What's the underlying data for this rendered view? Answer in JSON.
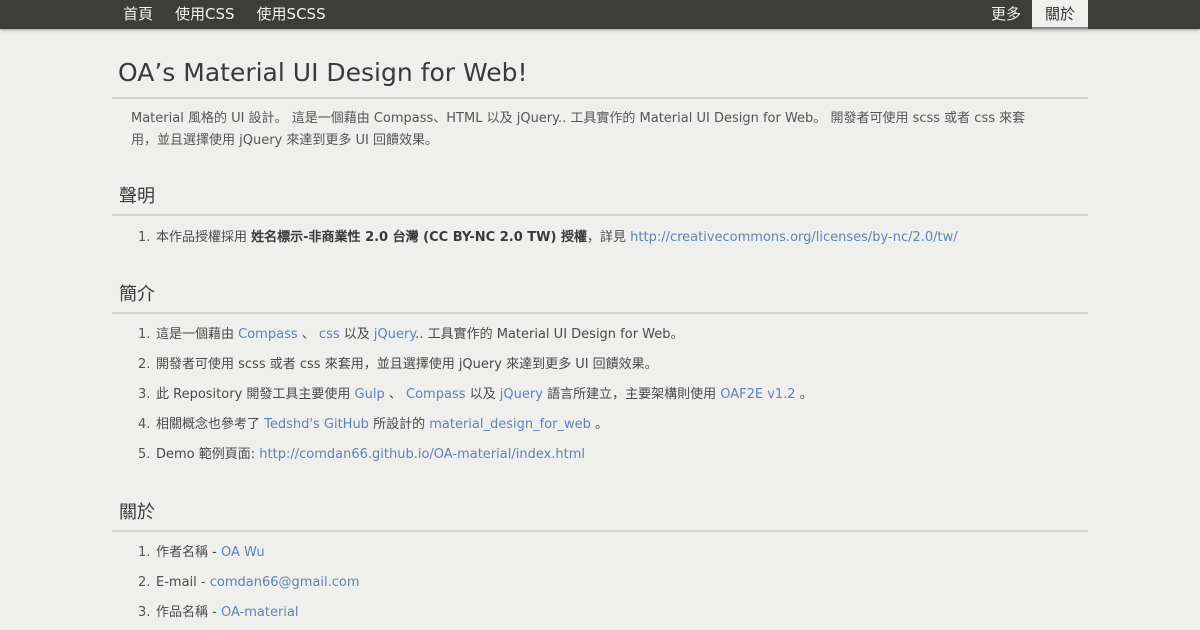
{
  "nav": {
    "left": [
      "首頁",
      "使用CSS",
      "使用SCSS"
    ],
    "right": [
      "更多",
      "關於"
    ]
  },
  "page": {
    "title": "OA’s Material UI Design for Web!",
    "intro": "Material 風格的 UI 設計。 這是一個藉由 Compass、HTML 以及 jQuery.. 工具實作的 Material UI Design for Web。 開發者可使用 scss 或者 css 來套用，並且選擇使用 jQuery 來達到更多 UI 回饋效果。"
  },
  "sections": {
    "statement": {
      "heading": "聲明",
      "item1": {
        "num": "1.",
        "prefix": "本作品授權採用",
        "bold": "姓名標示-非商業性 2.0 台灣 (CC BY-NC 2.0 TW) 授權",
        "mid": "，詳見",
        "link": "http://creativecommons.org/licenses/by-nc/2.0/tw/"
      }
    },
    "intro": {
      "heading": "簡介",
      "item1": {
        "num": "1.",
        "t1": "這是一個藉由",
        "l1": "Compass",
        "t2": "、",
        "l2": "css",
        "t3": "以及",
        "l3": "jQuery",
        "t4": ".. 工具實作的 Material UI Design for Web。"
      },
      "item2": {
        "num": "2.",
        "text": "開發者可使用 scss 或者 css 來套用，並且選擇使用 jQuery 來達到更多 UI 回饋效果。"
      },
      "item3": {
        "num": "3.",
        "t1": "此 Repository 開發工具主要使用",
        "l1": "Gulp",
        "t2": "、",
        "l2": "Compass",
        "t3": "以及",
        "l3": "jQuery",
        "t4": "語言所建立，主要架構則使用",
        "l4": "OAF2E v1.2",
        "t5": "。"
      },
      "item4": {
        "num": "4.",
        "t1": "相關概念也參考了",
        "l1": "Tedshd's GitHub",
        "t2": "所設計的",
        "l2": "material_design_for_web",
        "t3": "。"
      },
      "item5": {
        "num": "5.",
        "t1": "Demo 範例頁面:",
        "l1": "http://comdan66.github.io/OA-material/index.html"
      }
    },
    "about": {
      "heading": "關於",
      "item1": {
        "num": "1.",
        "label": "作者名稱 -",
        "link": "OA Wu"
      },
      "item2": {
        "num": "2.",
        "label": "E-mail -",
        "link": "comdan66@gmail.com"
      },
      "item3": {
        "num": "3.",
        "label": "作品名稱 -",
        "link": "OA-material"
      }
    }
  }
}
